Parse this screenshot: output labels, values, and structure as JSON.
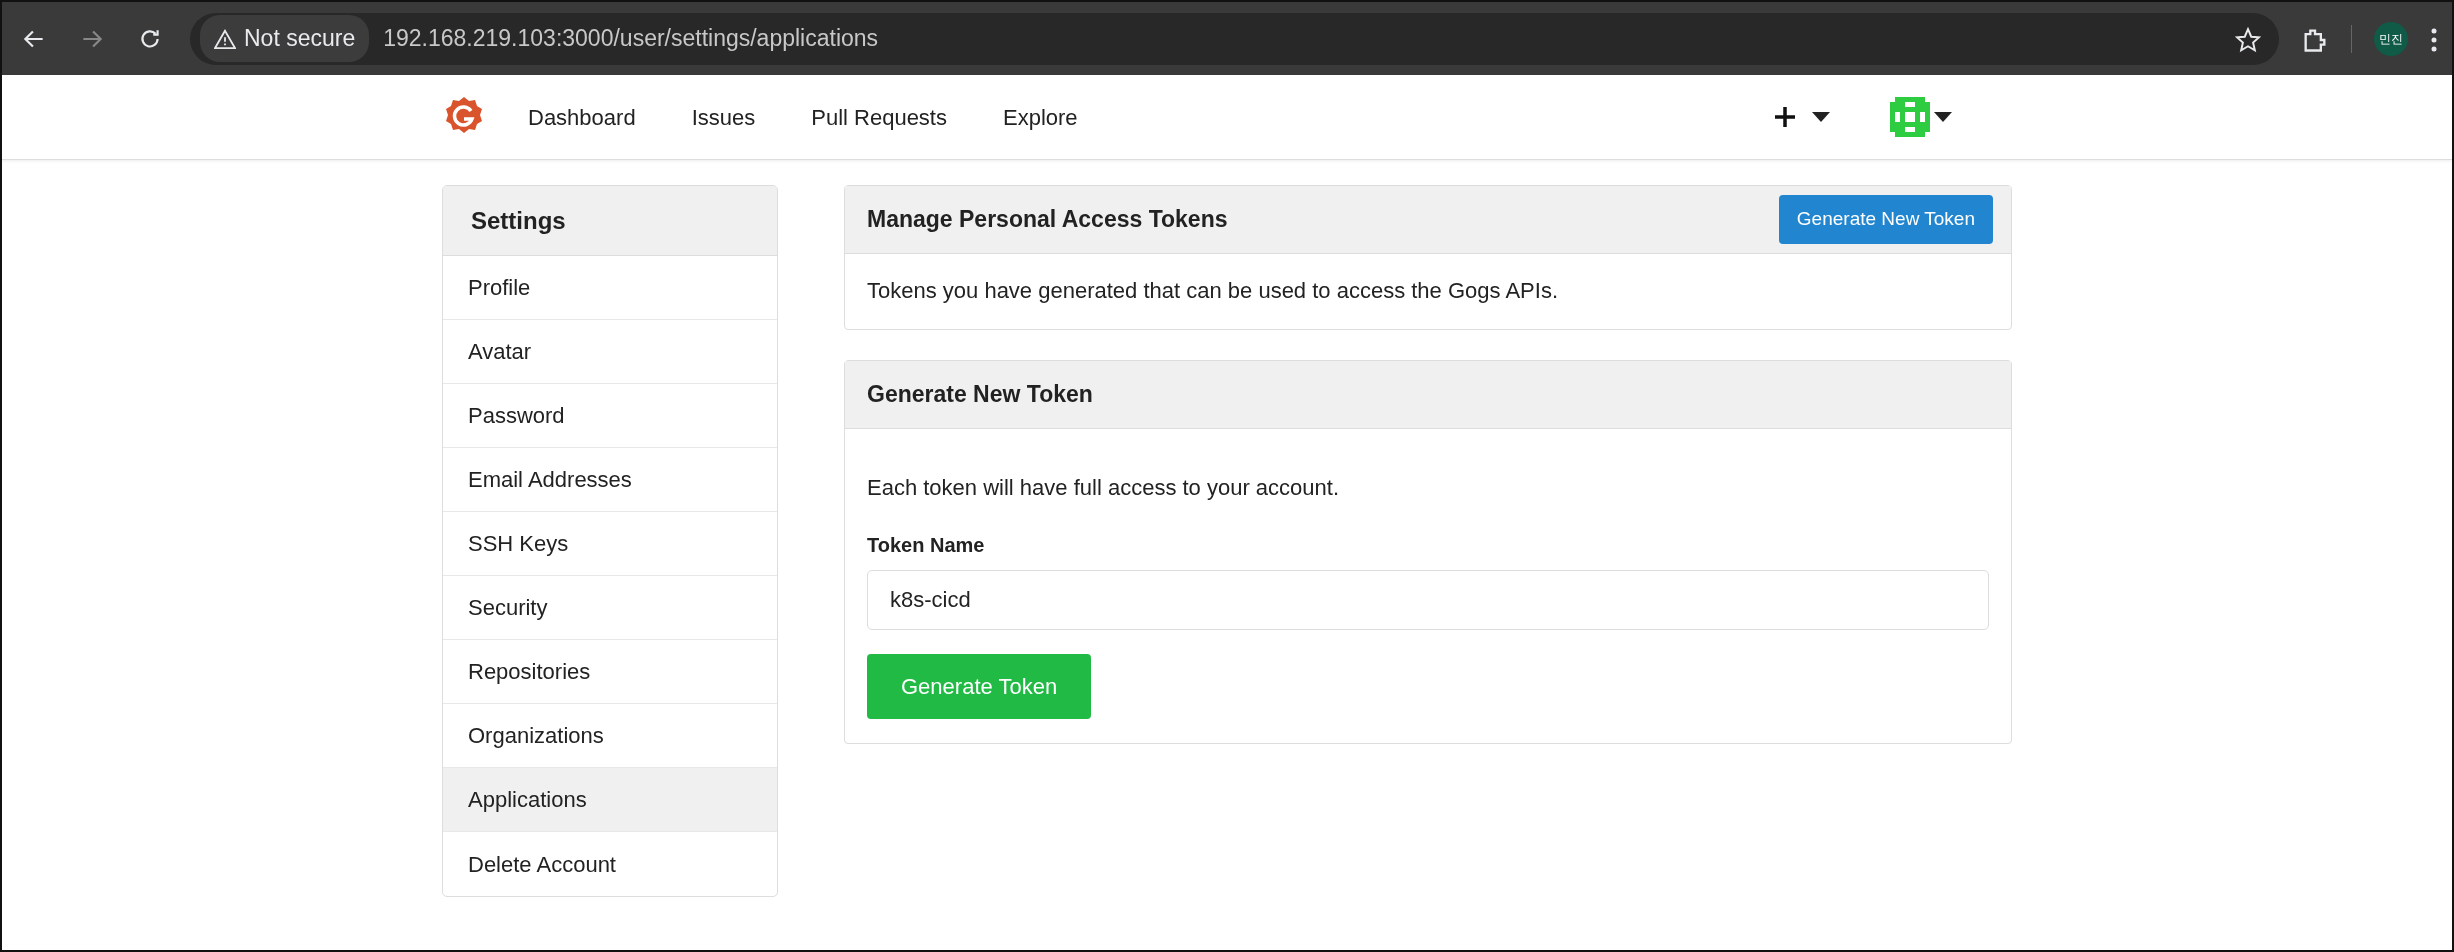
{
  "browser": {
    "security": "Not secure",
    "url": "192.168.219.103:3000/user/settings/applications",
    "profile": "민진"
  },
  "navbar": {
    "links": [
      {
        "label": "Dashboard"
      },
      {
        "label": "Issues"
      },
      {
        "label": "Pull Requests"
      },
      {
        "label": "Explore"
      }
    ]
  },
  "sidebar": {
    "title": "Settings",
    "items": [
      {
        "label": "Profile",
        "selected": false
      },
      {
        "label": "Avatar",
        "selected": false
      },
      {
        "label": "Password",
        "selected": false
      },
      {
        "label": "Email Addresses",
        "selected": false
      },
      {
        "label": "SSH Keys",
        "selected": false
      },
      {
        "label": "Security",
        "selected": false
      },
      {
        "label": "Repositories",
        "selected": false
      },
      {
        "label": "Organizations",
        "selected": false
      },
      {
        "label": "Applications",
        "selected": true
      },
      {
        "label": "Delete Account",
        "selected": false
      }
    ]
  },
  "tokens_panel": {
    "title": "Manage Personal Access Tokens",
    "button": "Generate New Token",
    "description": "Tokens you have generated that can be used to access the Gogs APIs."
  },
  "generate_panel": {
    "title": "Generate New Token",
    "description": "Each token will have full access to your account.",
    "field_label": "Token Name",
    "field_value": "k8s-cicd",
    "submit": "Generate Token"
  }
}
